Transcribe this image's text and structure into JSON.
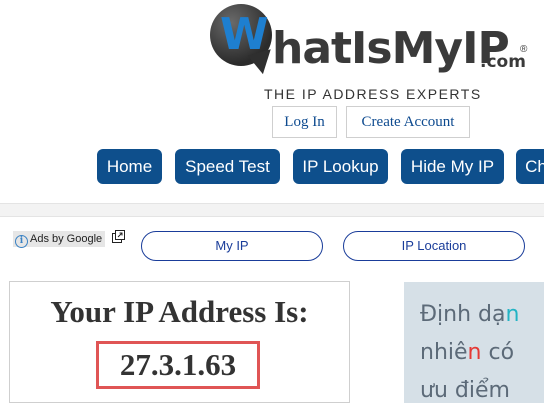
{
  "logo": {
    "w_letter": "W",
    "name_text": "hatIsMyIP",
    "com_text": ".com",
    "reg_mark": "®",
    "tagline": "THE IP ADDRESS EXPERTS"
  },
  "auth": {
    "login_label": "Log In",
    "create_account_label": "Create Account"
  },
  "nav": {
    "items": [
      {
        "label": "Home"
      },
      {
        "label": "Speed Test"
      },
      {
        "label": "IP Lookup"
      },
      {
        "label": "Hide My IP"
      },
      {
        "label": "Ch"
      }
    ]
  },
  "ads": {
    "info_glyph": "i",
    "label": "Ads by Google"
  },
  "quick_links": {
    "my_ip_label": "My IP",
    "ip_location_label": "IP Location"
  },
  "ip_panel": {
    "heading": "Your IP Address Is:",
    "ip_address": "27.3.1.63"
  },
  "promo": {
    "line1_a": "Định dạ",
    "line1_b": "n",
    "line2_a": "nhiê",
    "line2_b": "n",
    "line2_c": " có",
    "line3": "ưu điểm"
  },
  "colors": {
    "nav_bg": "#0e4f8c",
    "logo_blue": "#1e7fd0",
    "link_blue": "#1a3d9a",
    "highlight_red": "#e05555"
  }
}
